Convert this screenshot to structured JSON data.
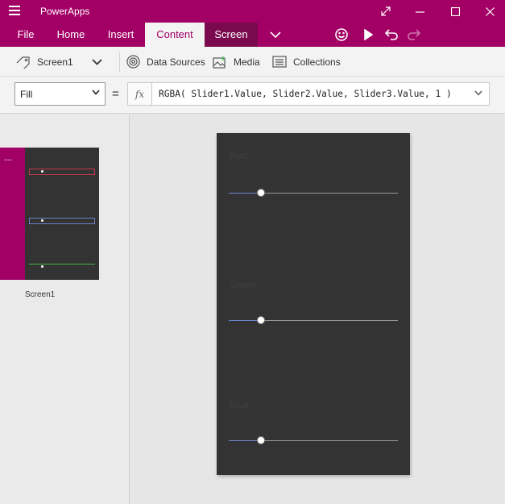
{
  "window": {
    "title": "PowerApps",
    "colors": {
      "accent": "#a30066",
      "canvas": "#333333",
      "slider_fill": "#6d86d6"
    }
  },
  "tabs": [
    {
      "label": "File"
    },
    {
      "label": "Home"
    },
    {
      "label": "Insert"
    },
    {
      "label": "Content"
    },
    {
      "label": "Screen"
    }
  ],
  "tab_icons": [
    "chevron-down-icon",
    "smiley-icon",
    "play-icon",
    "undo-icon",
    "redo-icon"
  ],
  "commands": {
    "screen_label": "Screen1",
    "data_sources": "Data Sources",
    "media": "Media",
    "collections": "Collections"
  },
  "formula_bar": {
    "property": "Fill",
    "equals": "=",
    "fx": "fx",
    "formula": "RGBA( Slider1.Value, Slider2.Value, Slider3.Value, 1 )"
  },
  "screens_panel": {
    "dots": "...",
    "thumbnail_label": "Screen1"
  },
  "canvas": {
    "sliders": [
      {
        "label": "Red",
        "value_fraction": 0.19
      },
      {
        "label": "Green",
        "value_fraction": 0.19
      },
      {
        "label": "Blue",
        "value_fraction": 0.19
      }
    ]
  }
}
